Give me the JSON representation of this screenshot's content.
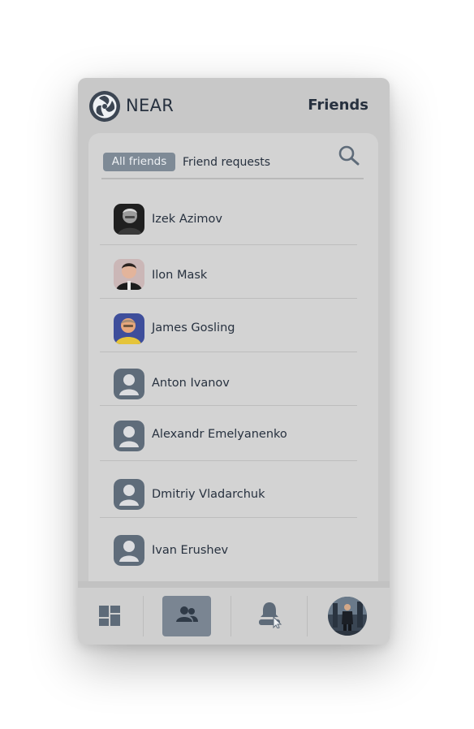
{
  "app": {
    "brand": "NEAR",
    "page_title": "Friends"
  },
  "tabs": [
    {
      "label": "All friends",
      "active": true
    },
    {
      "label": "Friend requests",
      "active": false
    }
  ],
  "friends": [
    {
      "name": "Izek Azimov",
      "avatar": "photo"
    },
    {
      "name": "Ilon Mask",
      "avatar": "photo"
    },
    {
      "name": "James Gosling",
      "avatar": "photo"
    },
    {
      "name": "Anton Ivanov",
      "avatar": "user-placeholder-icon"
    },
    {
      "name": "Alexandr Emelyanenko",
      "avatar": "user-placeholder-icon"
    },
    {
      "name": "Dmitriy Vladarchuk",
      "avatar": "user-placeholder-icon"
    },
    {
      "name": "Ivan Erushev",
      "avatar": "user-placeholder-icon"
    }
  ],
  "nav": [
    {
      "icon": "dashboard-icon",
      "active": false
    },
    {
      "icon": "friends-icon",
      "active": true
    },
    {
      "icon": "notification-bell-icon",
      "active": false
    },
    {
      "icon": "profile-avatar",
      "active": false
    }
  ],
  "colors": {
    "text": "#27313f",
    "active_tab": "#7e8a96",
    "panel": "#d3d3d3",
    "frame": "#c8c8c8",
    "icon": "#5e6b79"
  }
}
